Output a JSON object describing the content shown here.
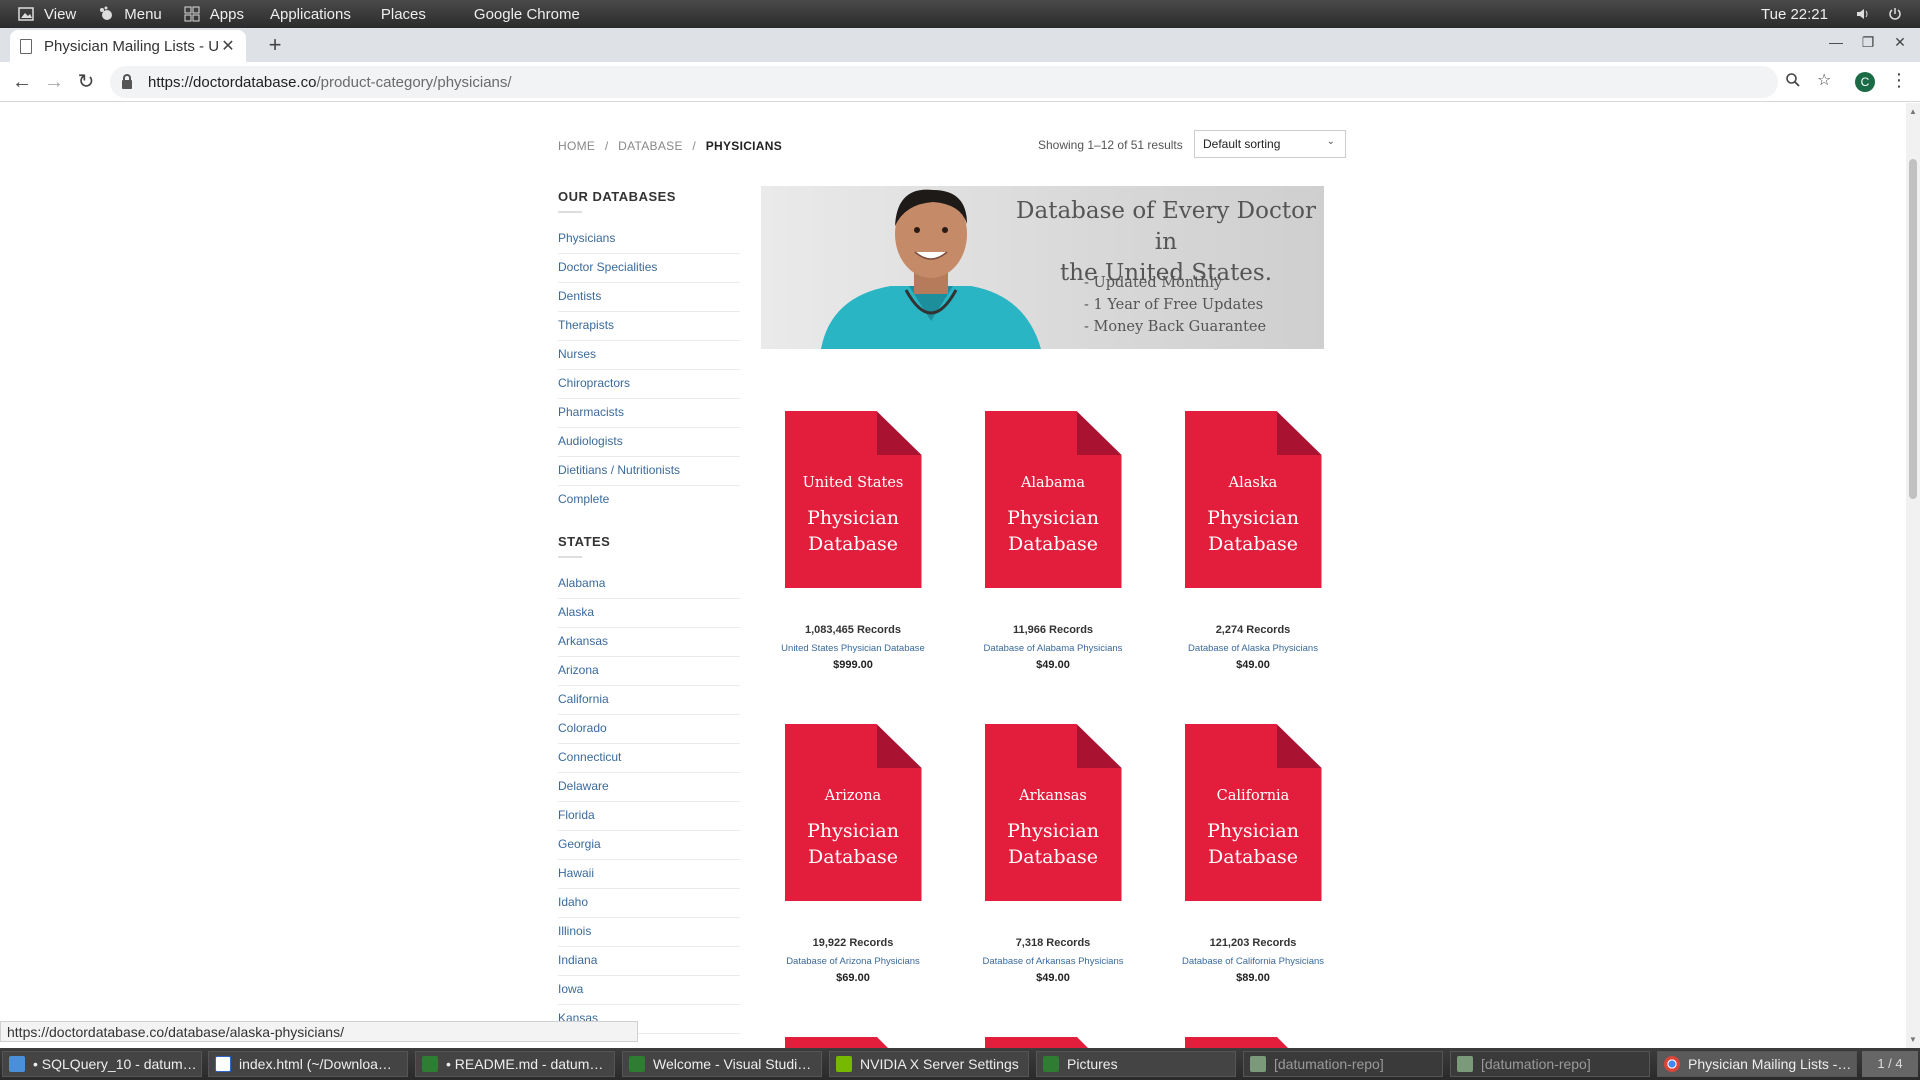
{
  "system_panel": {
    "items": [
      "View",
      "Menu",
      "Apps",
      "Applications",
      "Places",
      "Google Chrome"
    ],
    "clock": "Tue 22:21"
  },
  "browser": {
    "tab_title": "Physician Mailing Lists - Up",
    "url_host": "https://doctordatabase.co",
    "url_path": "/product-category/physicians/",
    "profile_initial": "C"
  },
  "breadcrumb": {
    "items": [
      "HOME",
      "DATABASE",
      "PHYSICIANS"
    ],
    "separator": "/"
  },
  "results": {
    "count_text": "Showing 1–12 of 51 results",
    "sort_selected": "Default sorting"
  },
  "sidebar": {
    "databases_heading": "OUR DATABASES",
    "databases": [
      "Physicians",
      "Doctor Specialities",
      "Dentists",
      "Therapists",
      "Nurses",
      "Chiropractors",
      "Pharmacists",
      "Audiologists",
      "Dietitians / Nutritionists",
      "Complete"
    ],
    "states_heading": "STATES",
    "states": [
      "Alabama",
      "Alaska",
      "Arkansas",
      "Arizona",
      "California",
      "Colorado",
      "Connecticut",
      "Delaware",
      "Florida",
      "Georgia",
      "Hawaii",
      "Idaho",
      "Illinois",
      "Indiana",
      "Iowa",
      "Kansas"
    ]
  },
  "banner": {
    "headline_line1": "Database of Every Doctor in",
    "headline_line2": "the United States.",
    "bullets": [
      "- Updated Monthly",
      "- 1 Year of Free Updates",
      "- Money Back Guarantee"
    ]
  },
  "products": [
    {
      "state": "United States",
      "title_line1": "Physician",
      "title_line2": "Database",
      "records": "1,083,465 Records",
      "name": "United States Physician Database",
      "price": "$999.00"
    },
    {
      "state": "Alabama",
      "title_line1": "Physician",
      "title_line2": "Database",
      "records": "11,966 Records",
      "name": "Database of Alabama Physicians",
      "price": "$49.00"
    },
    {
      "state": "Alaska",
      "title_line1": "Physician",
      "title_line2": "Database",
      "records": "2,274 Records",
      "name": "Database of Alaska Physicians",
      "price": "$49.00"
    },
    {
      "state": "Arizona",
      "title_line1": "Physician",
      "title_line2": "Database",
      "records": "19,922 Records",
      "name": "Database of Arizona Physicians",
      "price": "$69.00"
    },
    {
      "state": "Arkansas",
      "title_line1": "Physician",
      "title_line2": "Database",
      "records": "7,318 Records",
      "name": "Database of Arkansas Physicians",
      "price": "$49.00"
    },
    {
      "state": "California",
      "title_line1": "Physician",
      "title_line2": "Database",
      "records": "121,203 Records",
      "name": "Database of California Physicians",
      "price": "$89.00"
    }
  ],
  "status_bar_url": "https://doctordatabase.co/database/alaska-physicians/",
  "taskbar": {
    "tasks": [
      {
        "label": "• SQLQuery_10 - datum…",
        "state": "normal"
      },
      {
        "label": "index.html (~/Downloa…",
        "state": "normal"
      },
      {
        "label": "• README.md - datum…",
        "state": "normal"
      },
      {
        "label": "Welcome - Visual Studi…",
        "state": "normal"
      },
      {
        "label": "NVIDIA X Server Settings",
        "state": "normal"
      },
      {
        "label": "Pictures",
        "state": "normal"
      },
      {
        "label": "[datumation-repo]",
        "state": "dim"
      },
      {
        "label": "[datumation-repo]",
        "state": "dim"
      },
      {
        "label": "Physician Mailing Lists -…",
        "state": "active"
      }
    ],
    "workspace_pager": "1 / 4"
  },
  "colors": {
    "product_red": "#e31d3c",
    "product_fold": "#a91230",
    "link_blue": "#3a6a9c"
  }
}
